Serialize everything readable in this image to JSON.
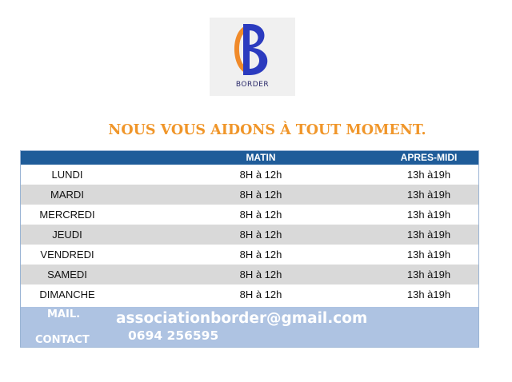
{
  "logo": {
    "icon": "border-b-logo-icon",
    "name": "BORDER"
  },
  "headline": "NOUS VOUS AIDONS À TOUT MOMENT.",
  "schedule": {
    "headers": {
      "day": "",
      "morning": "MATIN",
      "afternoon": "APRES-MIDI"
    },
    "rows": [
      {
        "day": "LUNDI",
        "morning": "8H à 12h",
        "afternoon": "13h à19h"
      },
      {
        "day": "MARDI",
        "morning": "8H à 12h",
        "afternoon": "13h à19h"
      },
      {
        "day": "MERCREDI",
        "morning": "8H à 12h",
        "afternoon": "13h à19h"
      },
      {
        "day": "JEUDI",
        "morning": "8H à 12h",
        "afternoon": "13h à19h"
      },
      {
        "day": "VENDREDI",
        "morning": "8H à 12h",
        "afternoon": "13h à19h"
      },
      {
        "day": "SAMEDI",
        "morning": "8H à 12h",
        "afternoon": "13h à19h"
      },
      {
        "day": "DIMANCHE",
        "morning": "8H à 12h",
        "afternoon": "13h à19h"
      }
    ]
  },
  "contact": {
    "mail_label": "MAIL.",
    "contact_label": "CONTACT",
    "email": "associationborder@gmail.com",
    "phone": "0694 256595"
  },
  "colors": {
    "accent": "#f0962a",
    "header_bg": "#1f5c99",
    "contact_bg": "#aec3e2",
    "row_shade": "#d9d9d9"
  }
}
